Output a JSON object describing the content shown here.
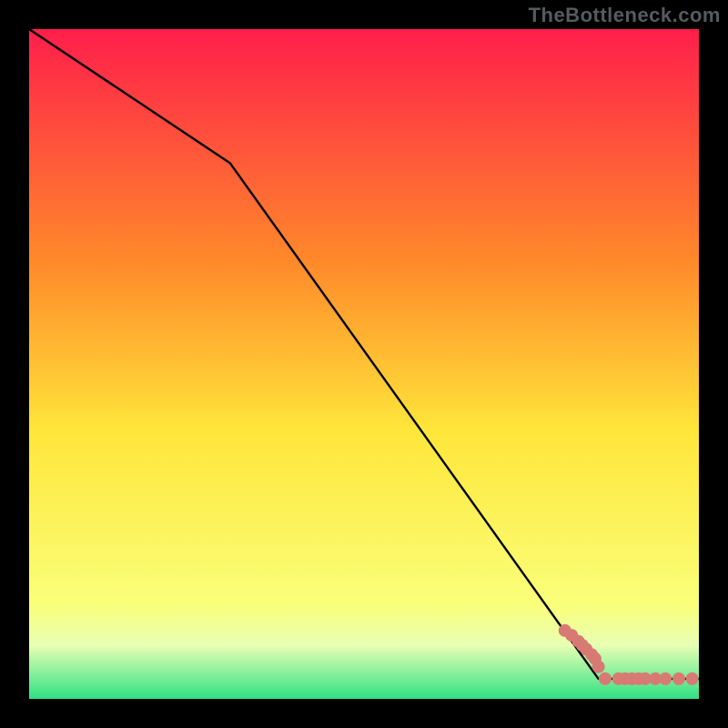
{
  "watermark": {
    "text": "TheBottleneck.com"
  },
  "colors": {
    "black": "#000000",
    "line": "#000000",
    "marker": "#d87a74",
    "grad_top": "#ff1e4b",
    "grad_mid1": "#ff8a2a",
    "grad_mid2": "#ffe63a",
    "grad_mid3": "#faff7a",
    "grad_mid4": "#e8ffb4",
    "grad_bot": "#2fe184"
  },
  "chart_data": {
    "type": "line",
    "title": "",
    "xlabel": "",
    "ylabel": "",
    "xlim": [
      0,
      100
    ],
    "ylim": [
      0,
      100
    ],
    "series": [
      {
        "name": "curve",
        "x": [
          0,
          30,
          85,
          100
        ],
        "y": [
          100,
          80,
          3,
          3
        ]
      }
    ],
    "markers": {
      "name": "points",
      "x": [
        80,
        81,
        82,
        82.6,
        83.2,
        84,
        84.5,
        85,
        86,
        88,
        89,
        90,
        91,
        92,
        93.5,
        95,
        97,
        99
      ],
      "y": [
        10.2,
        9.5,
        8.6,
        8.0,
        7.4,
        6.6,
        6.0,
        4.8,
        3.0,
        3.0,
        3.0,
        3.0,
        3.0,
        3.0,
        3.0,
        3.0,
        3.0,
        3.0
      ]
    },
    "gradient_stops": [
      {
        "offset": 0.0,
        "key": "grad_top"
      },
      {
        "offset": 0.35,
        "key": "grad_mid1"
      },
      {
        "offset": 0.6,
        "key": "grad_mid2"
      },
      {
        "offset": 0.86,
        "key": "grad_mid3"
      },
      {
        "offset": 0.92,
        "key": "grad_mid4"
      },
      {
        "offset": 1.0,
        "key": "grad_bot"
      }
    ]
  }
}
